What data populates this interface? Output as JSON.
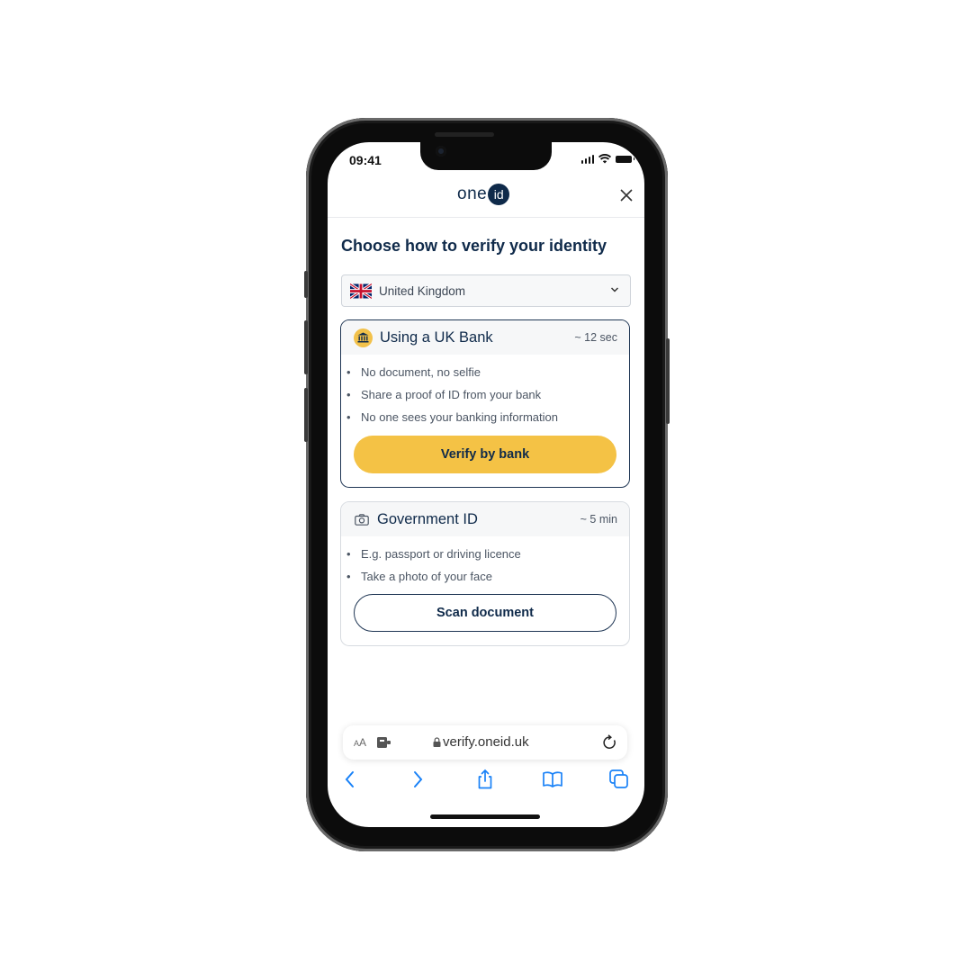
{
  "status_bar": {
    "time": "09:41"
  },
  "header": {
    "logo_text": "one",
    "logo_badge": "id",
    "close_icon": "close-icon"
  },
  "page": {
    "title": "Choose how to verify your identity"
  },
  "country_select": {
    "value": "United Kingdom",
    "flag_icon": "uk-flag-icon"
  },
  "options": [
    {
      "icon": "bank-icon",
      "title": "Using a UK Bank",
      "time": "~ 12 sec",
      "bullets": [
        "No document, no selfie",
        "Share a proof of ID from your bank",
        "No one sees your banking information"
      ],
      "button_label": "Verify by bank"
    },
    {
      "icon": "camera-icon",
      "title": "Government ID",
      "time": "~ 5 min",
      "bullets": [
        "E.g. passport or driving licence",
        "Take a photo of your face"
      ],
      "button_label": "Scan document"
    }
  ],
  "browser": {
    "text_size_label_small": "A",
    "text_size_label_large": "A",
    "url": "verify.oneid.uk",
    "toolbar": [
      "back",
      "forward",
      "share",
      "bookmarks",
      "tabs"
    ]
  },
  "colors": {
    "brand_navy": "#0f2a4a",
    "accent_yellow": "#f4c245",
    "ios_blue": "#1a82f7"
  }
}
